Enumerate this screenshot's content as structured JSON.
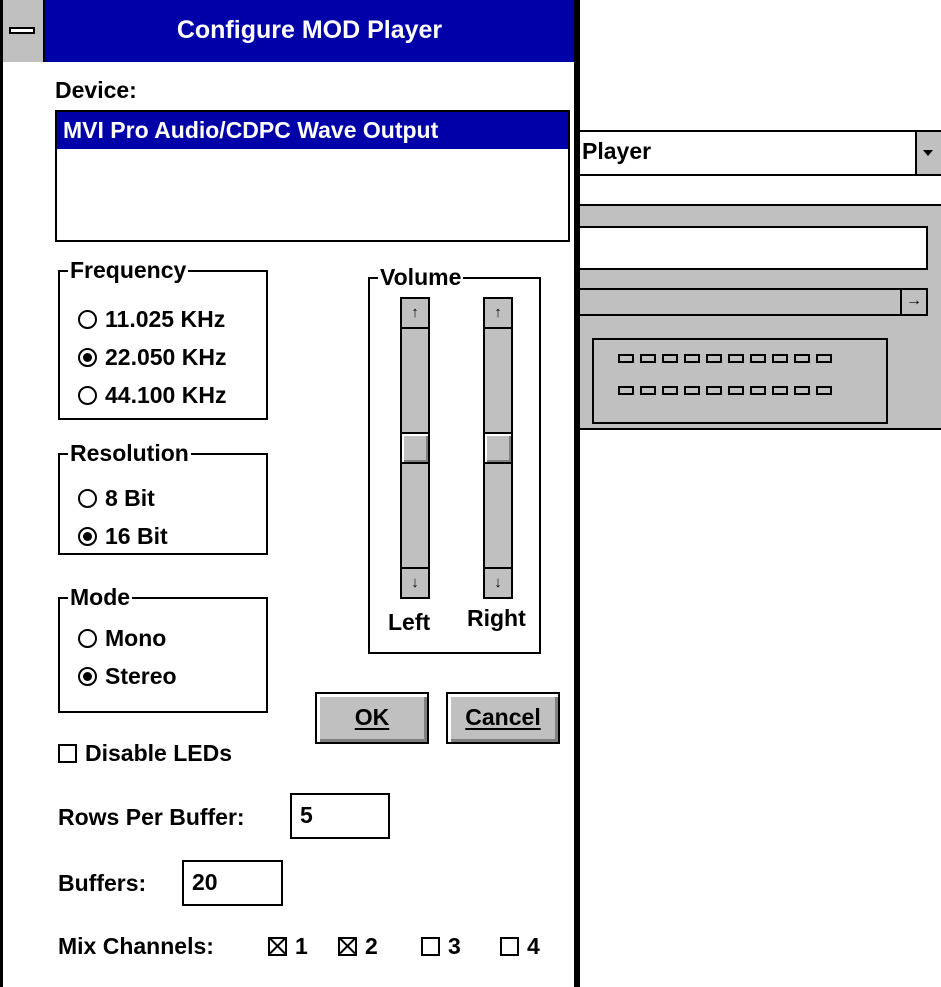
{
  "background_window": {
    "combo_text": "Player",
    "hscroll_arrow": "→",
    "led_rows": [
      10,
      10
    ]
  },
  "dialog": {
    "title": "Configure MOD Player",
    "device": {
      "label": "Device:",
      "selected_item": "MVI Pro Audio/CDPC Wave Output"
    },
    "frequency": {
      "title": "Frequency",
      "options": [
        {
          "label": "11.025 KHz",
          "checked": false
        },
        {
          "label": "22.050 KHz",
          "checked": true
        },
        {
          "label": "44.100 KHz",
          "checked": false
        }
      ]
    },
    "resolution": {
      "title": "Resolution",
      "options": [
        {
          "label": "8 Bit",
          "checked": false
        },
        {
          "label": "16 Bit",
          "checked": true
        }
      ]
    },
    "mode": {
      "title": "Mode",
      "options": [
        {
          "label": "Mono",
          "checked": false
        },
        {
          "label": "Stereo",
          "checked": true
        }
      ]
    },
    "volume": {
      "title": "Volume",
      "left_label": "Left",
      "right_label": "Right",
      "left_level": 0.5,
      "right_level": 0.5,
      "up_arrow": "↑",
      "down_arrow": "↓"
    },
    "buttons": {
      "ok": "OK",
      "cancel": "Cancel"
    },
    "disable_leds": {
      "label": "Disable LEDs",
      "checked": false
    },
    "rows_per_buffer": {
      "label": "Rows Per Buffer:",
      "value": "5"
    },
    "buffers": {
      "label": "Buffers:",
      "value": "20"
    },
    "mix_channels": {
      "label": "Mix Channels:",
      "channels": [
        {
          "label": "1",
          "checked": true
        },
        {
          "label": "2",
          "checked": true
        },
        {
          "label": "3",
          "checked": false
        },
        {
          "label": "4",
          "checked": false
        }
      ]
    }
  }
}
